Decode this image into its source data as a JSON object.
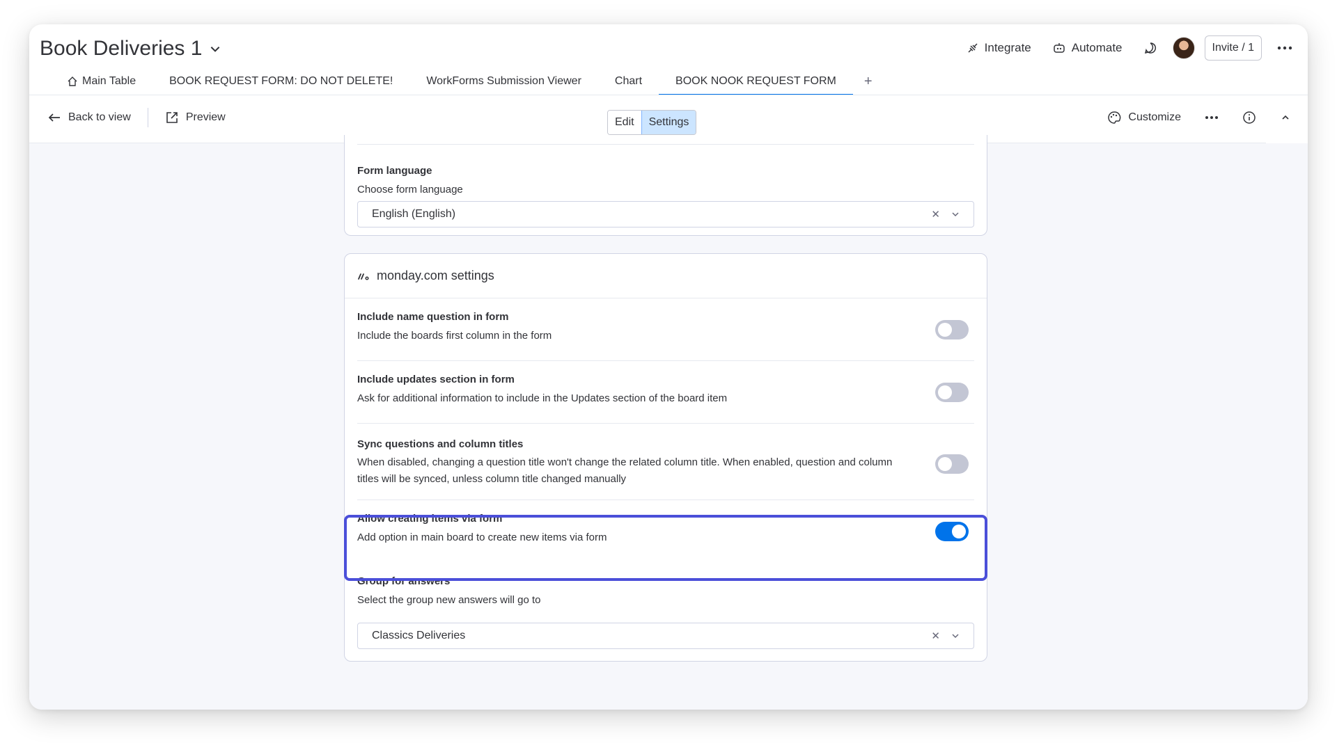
{
  "header": {
    "board_title": "Book Deliveries 1",
    "integrate_label": "Integrate",
    "automate_label": "Automate",
    "invite_label": "Invite / 1"
  },
  "tabs": [
    {
      "label": "Main Table",
      "icon": "home-icon"
    },
    {
      "label": "BOOK REQUEST FORM: DO NOT DELETE!"
    },
    {
      "label": "WorkForms Submission Viewer"
    },
    {
      "label": "Chart"
    },
    {
      "label": "BOOK NOOK REQUEST FORM",
      "active": true
    }
  ],
  "tab_add_label": "+",
  "toolbar": {
    "back_label": "Back to view",
    "preview_label": "Preview",
    "edit_label": "Edit",
    "settings_label": "Settings",
    "customize_label": "Customize"
  },
  "language": {
    "title": "Form language",
    "description": "Choose form language",
    "selected": "English (English)"
  },
  "monday_settings": {
    "title": "monday.com settings",
    "rows": [
      {
        "title": "Include name question in form",
        "description": "Include the boards first column in the form",
        "enabled": false
      },
      {
        "title": "Include updates section in form",
        "description": "Ask for additional information to include in the Updates section of the board item",
        "enabled": false
      },
      {
        "title": "Sync questions and column titles",
        "description": "When disabled, changing a question title won't change the related column title. When enabled, question and column titles will be synced, unless column title changed manually",
        "enabled": false
      },
      {
        "title": "Allow creating items via form",
        "description": "Add option in main board to create new items via form",
        "enabled": true
      }
    ],
    "group": {
      "title": "Group for answers",
      "description": "Select the group new answers will go to",
      "selected": "Classics Deliveries"
    }
  },
  "colors": {
    "accent": "#0073ea",
    "highlight": "#4b4fd9",
    "segment_active": "#cce5ff"
  }
}
